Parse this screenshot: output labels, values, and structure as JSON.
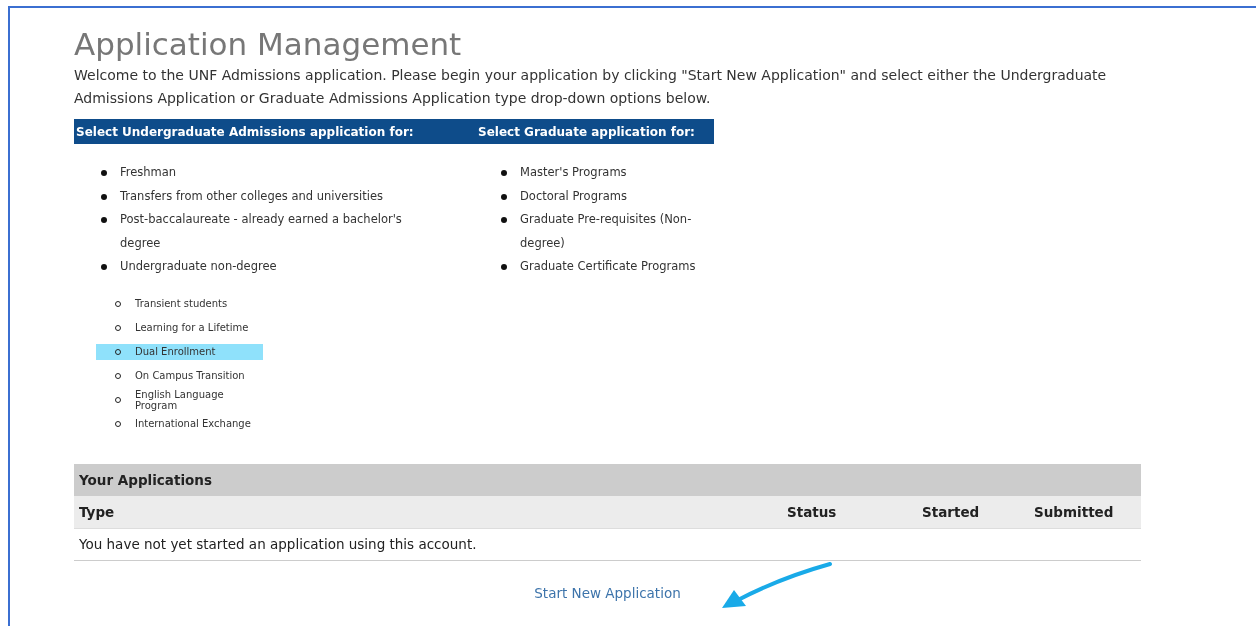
{
  "title": "Application Management",
  "intro": "Welcome to the UNF Admissions application. Please begin your application by clicking \"Start New Application\" and select either the Undergraduate Admissions Application or Graduate Admissions Application type drop-down options below.",
  "columns": [
    {
      "heading": "Select Undergraduate Admissions application for:",
      "items": [
        {
          "label": "Freshman"
        },
        {
          "label": "Transfers from other colleges and universities"
        },
        {
          "label": "Post-baccalaureate - already earned a bachelor's degree"
        },
        {
          "label": "Undergraduate non-degree",
          "children": [
            {
              "label": "Transient students",
              "highlighted": false
            },
            {
              "label": "Learning for a Lifetime",
              "highlighted": false
            },
            {
              "label": "Dual Enrollment",
              "highlighted": true
            },
            {
              "label": "On Campus Transition",
              "highlighted": false
            },
            {
              "label": "English Language Program",
              "highlighted": false
            },
            {
              "label": "International Exchange",
              "highlighted": false
            }
          ]
        }
      ]
    },
    {
      "heading": "Select Graduate application for:",
      "items": [
        {
          "label": "Master's Programs"
        },
        {
          "label": "Doctoral Programs"
        },
        {
          "label": "Graduate Pre-requisites (Non-degree)"
        },
        {
          "label": "Graduate Certificate Programs"
        }
      ]
    }
  ],
  "applications": {
    "title": "Your Applications",
    "columns": [
      "Type",
      "Status",
      "Started",
      "Submitted"
    ],
    "empty_message": "You have not yet started an application using this account."
  },
  "link": "Start New Application"
}
